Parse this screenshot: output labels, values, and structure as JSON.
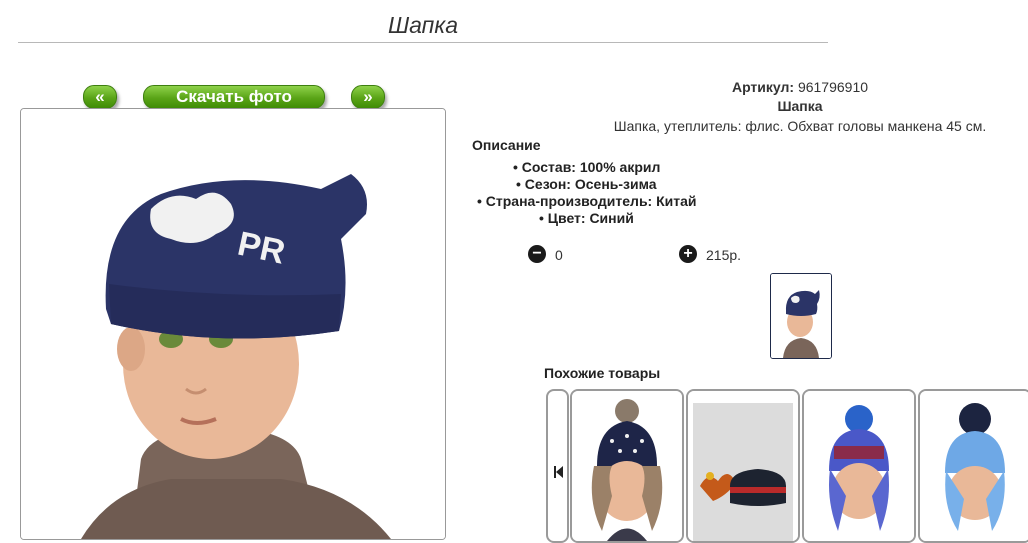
{
  "page": {
    "title": "Шапка"
  },
  "nav": {
    "prev": "«",
    "download": "Скачать фото",
    "next": "»"
  },
  "product": {
    "article_label": "Артикул:",
    "article_value": "961796910",
    "name": "Шапка",
    "short_desc": "Шапка, утеплитель: флис. Обхват головы манкена 45 см.",
    "description_title": "Описание",
    "features": [
      "• Состав: 100% акрил",
      "• Сезон: Осень-зима",
      "• Страна-производитель: Китай",
      "• Цвет: Синий"
    ],
    "quantity": "0",
    "price": "215р.",
    "colors": {
      "hat": "#2b3467",
      "sweater": "#7a655a",
      "skin": "#e9b898"
    }
  },
  "icons": {
    "minus": "minus-circle-icon",
    "plus": "plus-circle-icon",
    "first": "skip-to-start-icon"
  },
  "similar": {
    "title": "Похожие товары"
  },
  "accent": "#5aa417"
}
